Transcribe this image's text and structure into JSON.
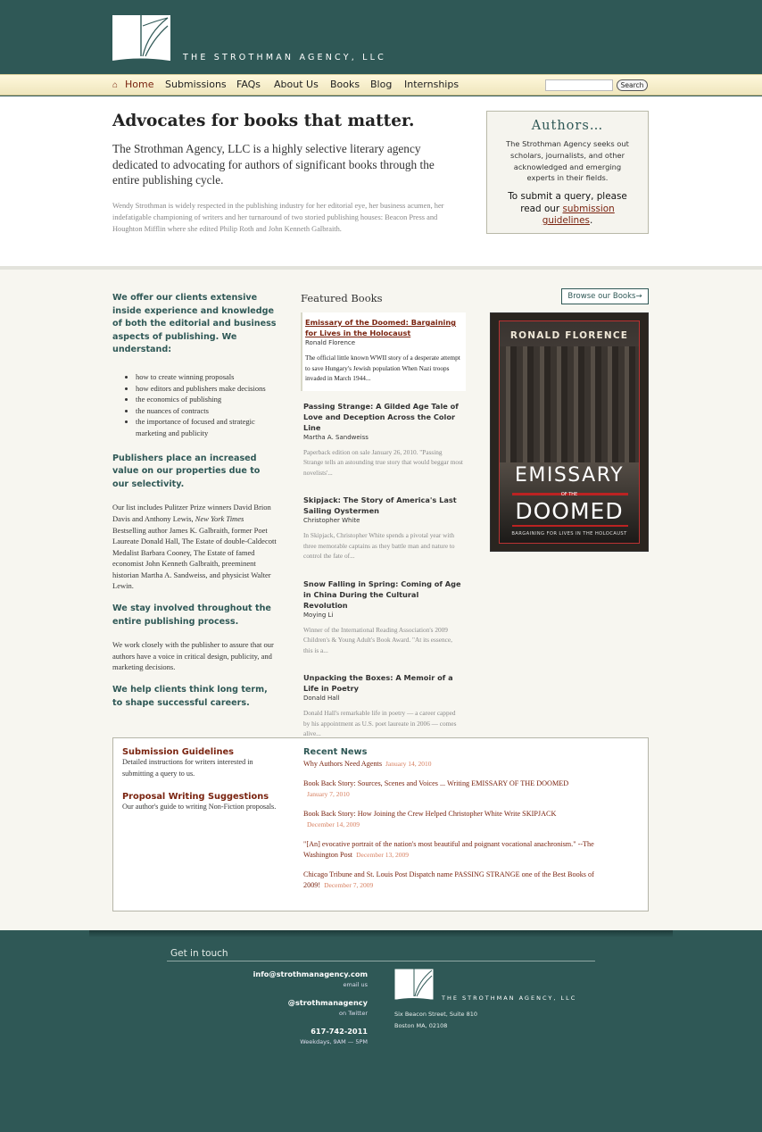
{
  "brand": {
    "name": "The Strothman Agency, LLC"
  },
  "nav": {
    "items": [
      "Home",
      "Submissions",
      "FAQs",
      "About Us",
      "Books",
      "Blog",
      "Internships"
    ],
    "search_button": "Search",
    "search_placeholder": ""
  },
  "intro": {
    "heading": "Advocates for books that matter.",
    "lead": "The Strothman Agency, LLC is a highly selective literary agency dedicated to advocating for authors of significant books through the entire publishing cycle.",
    "detail": "Wendy Strothman is widely respected in the publishing industry for her editorial eye, her business acumen, her indefatigable championing of writers and her turnaround of two storied publishing houses: Beacon Press and Houghton Mifflin where she edited Philip Roth and John Kenneth Galbraith."
  },
  "authors_box": {
    "title": "Authors…",
    "desc": "The Strothman Agency seeks out scholars, journalists, and other acknowledged and emerging experts in their fields.",
    "query_prefix": "To submit a query, please read our",
    "query_link": "submission guidelines",
    "query_suffix": "."
  },
  "left_col": {
    "h1": "We offer our clients extensive inside experience and knowledge of both the editorial and business aspects of publishing. We understand:",
    "bullets": [
      "how to create winning proposals",
      "how editors and publishers make decisions",
      "the economics of publishing",
      "the nuances of contracts",
      "the importance of focused and strategic marketing and publicity"
    ],
    "h2": "Publishers place an increased value on our properties due to our selectivity.",
    "p2_a": "Our list includes Pulitzer Prize winners David Brion Davis and Anthony Lewis, ",
    "p2_em": "New York Times",
    "p2_b": " Bestselling author James K. Galbraith, former Poet Laureate Donald Hall, The Estate of double-Caldecott Medalist Barbara Cooney, The Estate of famed economist John Kenneth Galbraith, preeminent historian Martha A. Sandweiss, and physicist Walter Lewin.",
    "h3": "We stay involved throughout the entire publishing process.",
    "p3": "We work closely  with the publisher to assure that our authors have a voice in critical design, publicity, and marketing decisions.",
    "h4": "We help clients think long term, to shape successful careers."
  },
  "featured": {
    "title": "Featured Books",
    "browse": "Browse our Books→",
    "books": [
      {
        "title": "Emissary of the Doomed: Bargaining for Lives in the Holocaust",
        "author": "Ronald Florence",
        "desc": "The official little known WWII story of a desperate attempt to save Hungary's Jewish population When Nazi troops invaded in March 1944..."
      },
      {
        "title": "Passing Strange: A Gilded Age Tale of Love and Deception Across the Color Line",
        "author": "Martha A. Sandweiss",
        "desc": "Paperback edition on sale January 26, 2010. \"Passing Strange tells an astounding true story that would beggar most novelists'..."
      },
      {
        "title": "Skipjack: The Story of America's Last Sailing Oystermen",
        "author": "Christopher White",
        "desc": "In Skipjack, Christopher White spends a pivotal year with three memorable captains as they battle man and nature to control the fate of..."
      },
      {
        "title": "Snow Falling in Spring: Coming of Age in China During the Cultural Revolution",
        "author": "Moying Li",
        "desc": "Winner of the International Reading Association's 2009 Children's & Young Adult's Book Award.  \"At its essence, this is a..."
      },
      {
        "title": "Unpacking the Boxes: A Memoir of a Life in Poetry",
        "author": "Donald Hall",
        "desc": "Donald Hall's remarkable life in poetry — a career capped by his appointment as U.S. poet laureate in 2006 — comes alive..."
      }
    ],
    "cover": {
      "author": "RONALD FLORENCE",
      "title1": "EMISSARY",
      "of": "OF THE",
      "title2": "DOOMED",
      "subtitle": "BARGAINING FOR LIVES IN THE HOLOCAUST"
    }
  },
  "bottom": {
    "links": [
      {
        "title": "Submission Guidelines",
        "desc": "Detailed instructions for writers interested in submitting a query to us."
      },
      {
        "title": "Proposal Writing Suggestions",
        "desc": "Our author's guide to writing  Non-Fiction proposals."
      }
    ],
    "news_title": "Recent News",
    "news": [
      {
        "text": "Why Authors Need Agents",
        "date": "January 14, 2010"
      },
      {
        "text": "Book Back Story: Sources, Scenes and Voices ... Writing EMISSARY OF THE DOOMED",
        "date": "January 7, 2010"
      },
      {
        "text": "Book Back Story: How Joining the Crew Helped Christopher White Write SKIPJACK",
        "date": "December 14, 2009"
      },
      {
        "text": "\"[An] evocative portrait of the nation's most beautiful and poignant vocational anachronism.\" --The Washington Post",
        "date": "December 13, 2009"
      },
      {
        "text": "Chicago Tribune and St. Louis Post Dispatch name PASSING STRANGE one of the Best Books of 2009!",
        "date": "December 7, 2009"
      }
    ]
  },
  "footer": {
    "title": "Get in touch",
    "email": "info@strothmanagency.com",
    "email_label": "email us",
    "twitter": "@strothmanagency",
    "twitter_label": "on Twitter",
    "phone": "617-742-2011",
    "hours": "Weekdays, 9AM — 5PM",
    "brand": "The Strothman Agency, LLC",
    "address1": "Six Beacon Street, Suite 810",
    "address2": "Boston MA, 02108"
  },
  "colors": {
    "teal": "#2f5856",
    "accent": "#7a2410",
    "date": "#d77f5f",
    "nav_bg": "#fff8dc"
  }
}
